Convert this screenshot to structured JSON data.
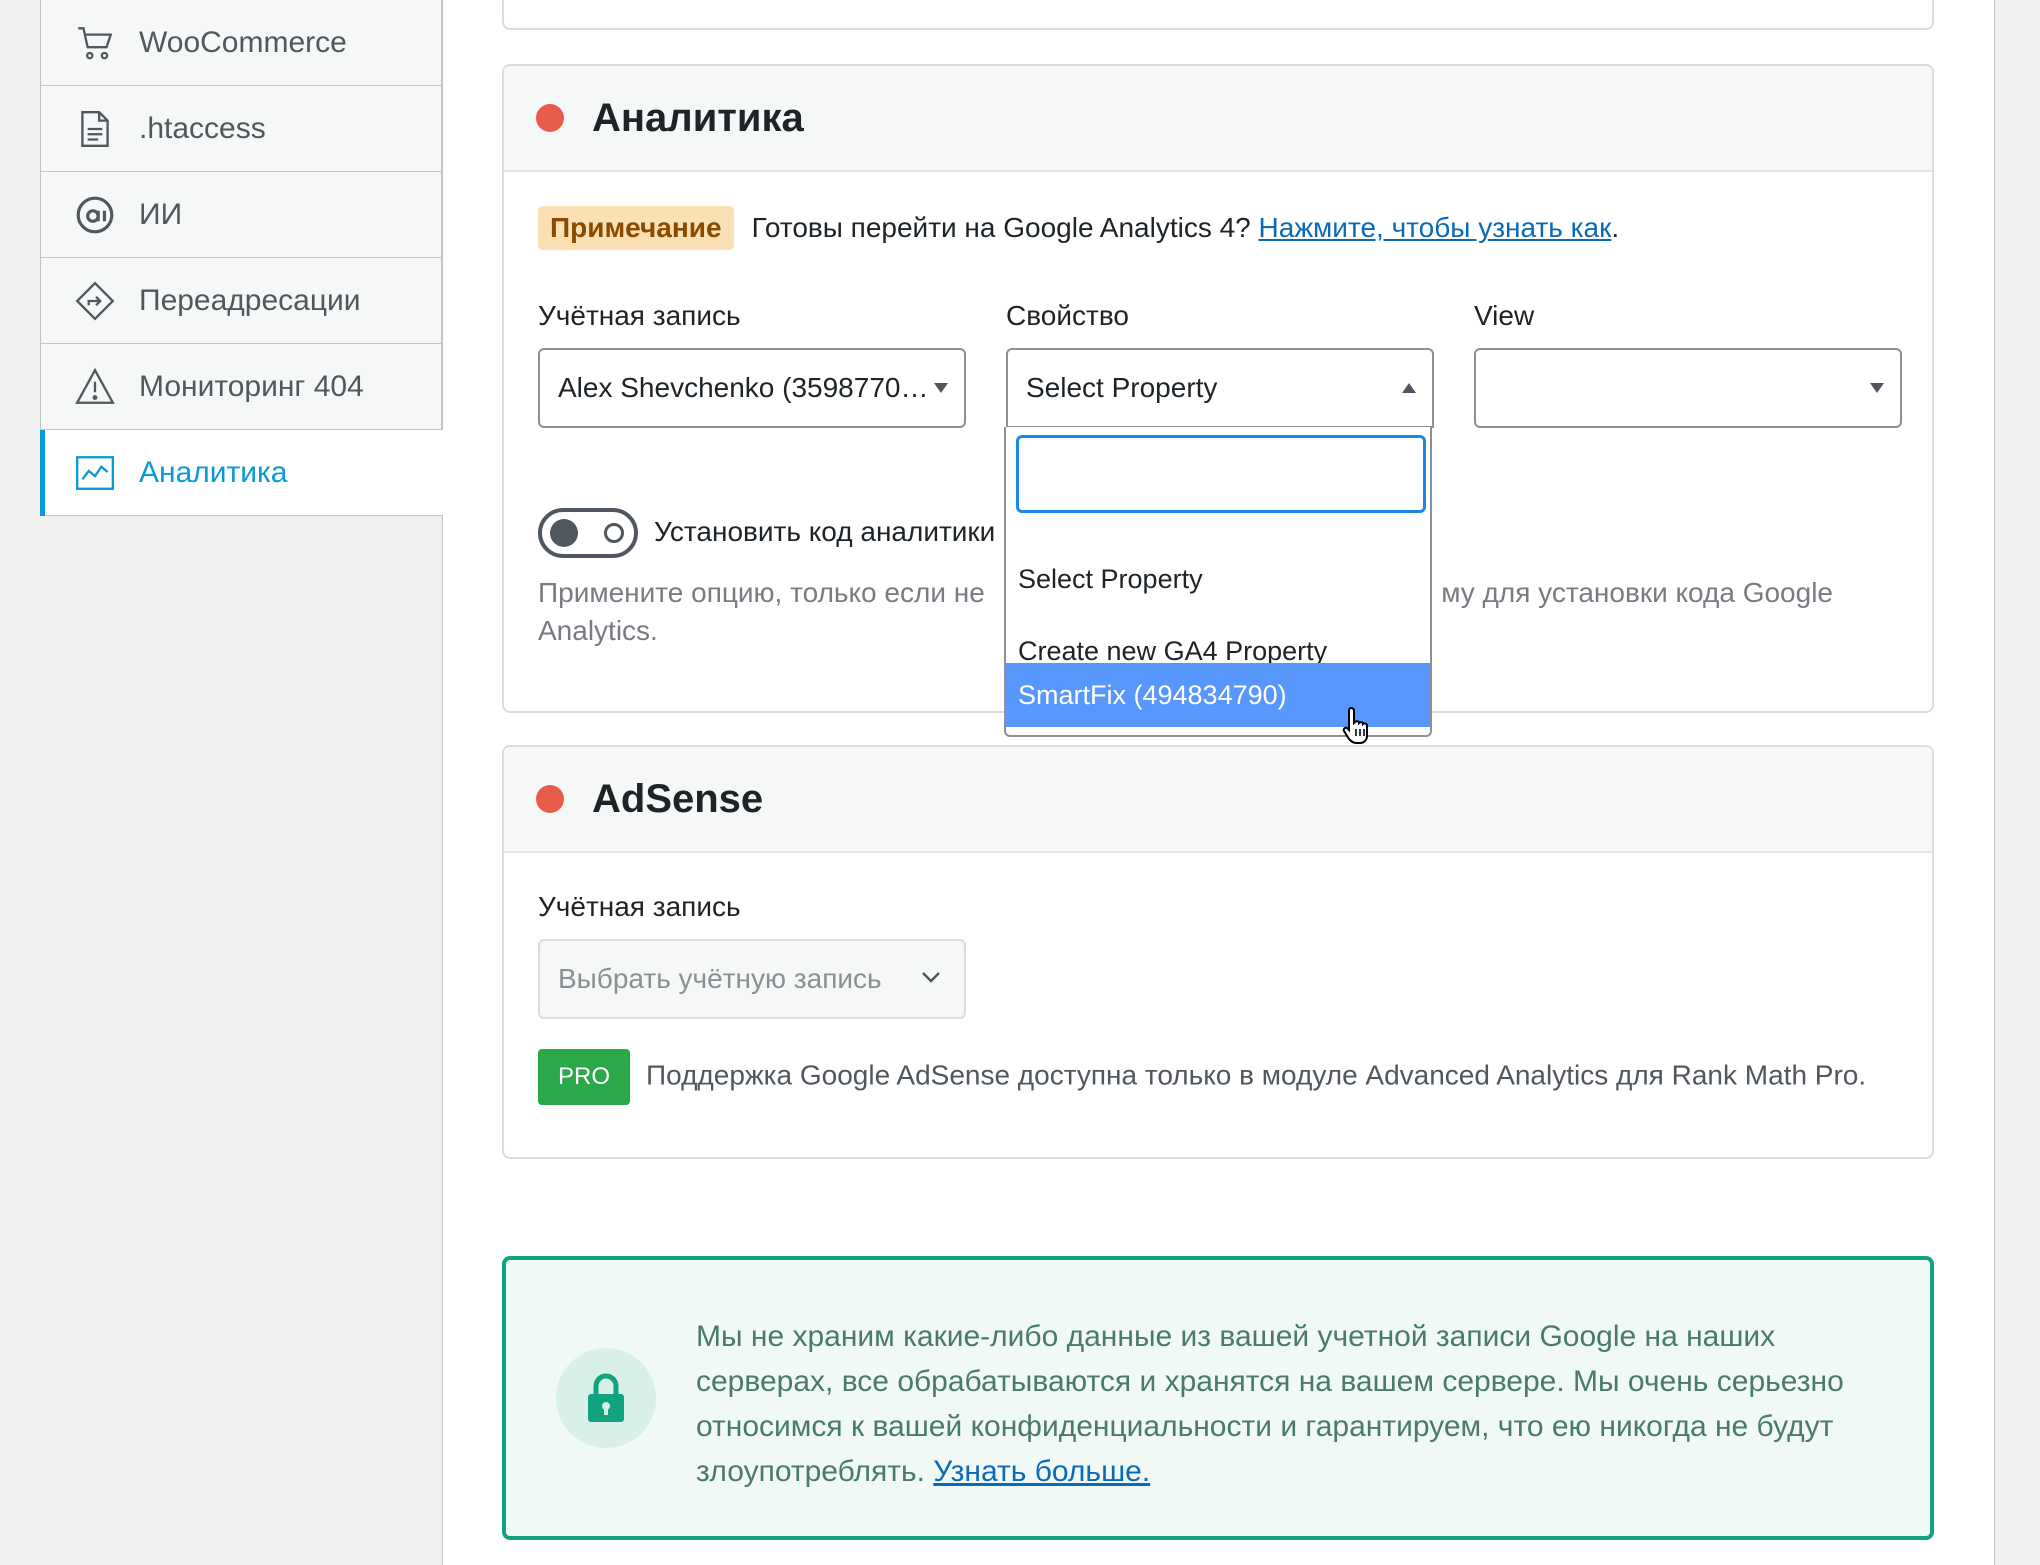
{
  "sidebar": {
    "items": [
      {
        "label": "WooCommerce",
        "icon": "cart-icon"
      },
      {
        "label": ".htaccess",
        "icon": "file-icon"
      },
      {
        "label": "ИИ",
        "icon": "ai-icon"
      },
      {
        "label": "Переадресации",
        "icon": "redirect-icon"
      },
      {
        "label": "Мониторинг 404",
        "icon": "warning-icon"
      },
      {
        "label": "Аналитика",
        "icon": "chart-line-icon",
        "active": true
      }
    ]
  },
  "analytics": {
    "title": "Аналитика",
    "status_color": "#e85c4b",
    "notice_badge": "Примечание",
    "notice_text": "Готовы перейти на Google Analytics 4?",
    "notice_link": "Нажмите, чтобы узнать как",
    "notice_period": ".",
    "account_label": "Учётная запись",
    "account_value": "Alex Shevchenko (3598770…",
    "property_label": "Свойство",
    "property_value": "Select Property",
    "view_label": "View",
    "view_value": "",
    "toggle_label": "Установить код аналитики",
    "help_left": "Примените опцию, только если не",
    "help_right": "му для установки кода Google",
    "help_line2": "Analytics.",
    "dropdown": {
      "search_value": "",
      "options": [
        "Select Property",
        "Create new GA4 Property",
        "SmartFix (494834790)"
      ],
      "selected_index": 2
    }
  },
  "adsense": {
    "title": "AdSense",
    "status_color": "#e85c4b",
    "account_label": "Учётная запись",
    "account_placeholder": "Выбрать учётную запись",
    "pro_badge": "PRO",
    "pro_text": "Поддержка Google AdSense доступна только в модуле Advanced Analytics для Rank Math Pro."
  },
  "privacy": {
    "text": "Мы не храним какие-либо данные из вашей учетной записи Google на наших серверах, все обрабатываются и хранятся на вашем сервере. Мы очень серьезно относимся к вашей конфиденциальности и гарантируем, что ею никогда не будут злоупотреблять.",
    "link": "Узнать больше."
  },
  "colors": {
    "accent": "#0a9ad6",
    "link": "#0a6ab8",
    "selected_option": "#5897fb",
    "pro": "#2ba84a",
    "privacy_border": "#10a37f"
  }
}
